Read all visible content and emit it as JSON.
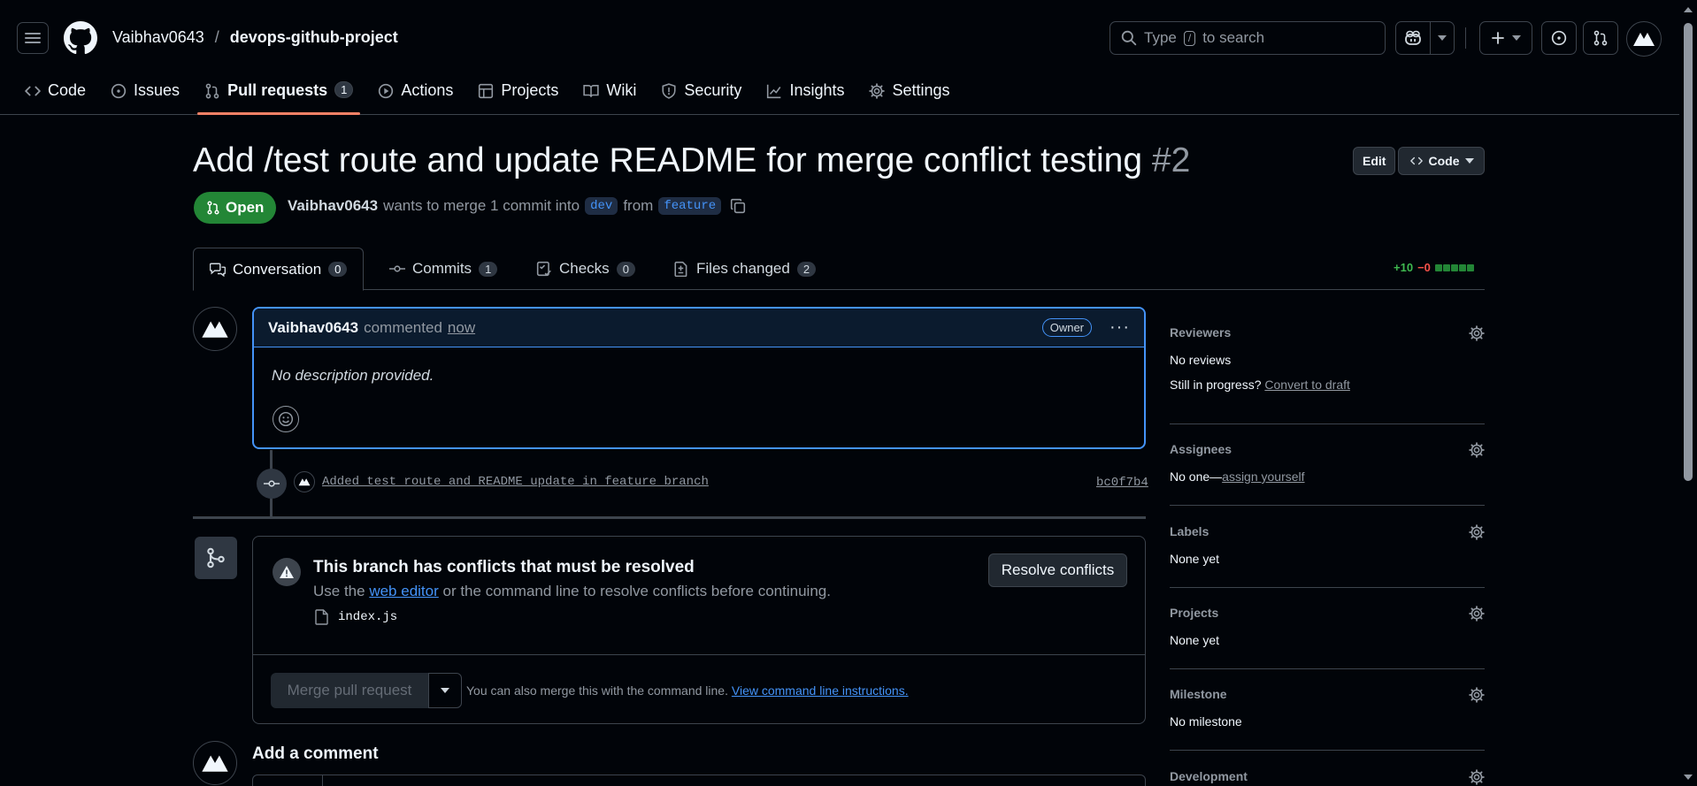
{
  "header": {
    "owner": "Vaibhav0643",
    "separator": "/",
    "repo": "devops-github-project",
    "search_placeholder_pre": "Type",
    "search_key": "/",
    "search_placeholder_post": "to search"
  },
  "repo_tabs": [
    {
      "label": "Code",
      "icon": "code-icon"
    },
    {
      "label": "Issues",
      "icon": "issue-opened-icon"
    },
    {
      "label": "Pull requests",
      "icon": "git-pull-request-icon",
      "count": "1",
      "selected": true
    },
    {
      "label": "Actions",
      "icon": "play-icon"
    },
    {
      "label": "Projects",
      "icon": "table-icon"
    },
    {
      "label": "Wiki",
      "icon": "book-icon"
    },
    {
      "label": "Security",
      "icon": "shield-icon"
    },
    {
      "label": "Insights",
      "icon": "graph-icon"
    },
    {
      "label": "Settings",
      "icon": "gear-icon"
    }
  ],
  "pr": {
    "title": "Add /test route and update README for merge conflict testing",
    "number": "#2",
    "edit_label": "Edit",
    "code_label": "Code",
    "state": "Open",
    "author": "Vaibhav0643",
    "merge_text": "wants to merge 1 commit into",
    "base": "dev",
    "from_text": "from",
    "head": "feature"
  },
  "pr_tabs": {
    "conversation": {
      "label": "Conversation",
      "count": "0"
    },
    "commits": {
      "label": "Commits",
      "count": "1"
    },
    "checks": {
      "label": "Checks",
      "count": "0"
    },
    "files": {
      "label": "Files changed",
      "count": "2"
    }
  },
  "diffstat": {
    "additions": "+10",
    "deletions": "−0"
  },
  "comment": {
    "author": "Vaibhav0643",
    "action": "commented",
    "time": "now",
    "role": "Owner",
    "body": "No description provided."
  },
  "commit": {
    "message": "Added test route and README update in feature branch",
    "sha": "bc0f7b4"
  },
  "merge": {
    "title": "This branch has conflicts that must be resolved",
    "sub_pre": "Use the",
    "sub_link": "web editor",
    "sub_post": "or the command line to resolve conflicts before continuing.",
    "file": "index.js",
    "resolve_label": "Resolve conflicts",
    "merge_label": "Merge pull request",
    "hint": "You can also merge this with the command line.",
    "hint_link": "View command line instructions."
  },
  "add_comment": "Add a comment",
  "sidebar": {
    "reviewers": {
      "label": "Reviewers",
      "value": "No reviews",
      "extra_pre": "Still in progress?",
      "extra_link": "Convert to draft"
    },
    "assignees": {
      "label": "Assignees",
      "value_pre": "No one—",
      "value_link": "assign yourself"
    },
    "labels": {
      "label": "Labels",
      "value": "None yet"
    },
    "projects": {
      "label": "Projects",
      "value": "None yet"
    },
    "milestone": {
      "label": "Milestone",
      "value": "No milestone"
    },
    "development": {
      "label": "Development"
    }
  }
}
